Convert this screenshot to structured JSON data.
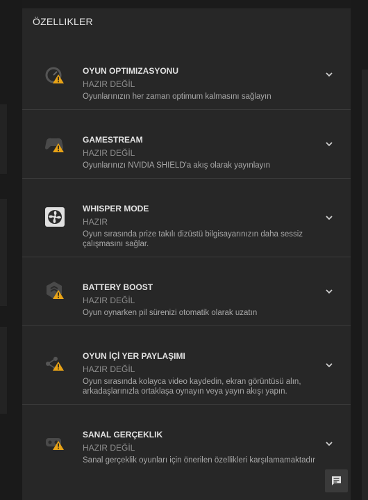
{
  "panel": {
    "title": "ÖZELLIKLER"
  },
  "features": [
    {
      "name": "OYUN OPTIMIZASYONU",
      "status": "HAZIR DEĞİL",
      "description": "Oyunlarınızın her zaman optimum kalmasını sağlayın",
      "icon": "game-optimization-icon",
      "warning": true
    },
    {
      "name": "GAMESTREAM",
      "status": "HAZIR DEĞİL",
      "description": "Oyunlarınızı NVIDIA SHIELD'a akış olarak yayınlayın",
      "icon": "gamestream-controller-icon",
      "warning": true
    },
    {
      "name": "WHISPER MODE",
      "status": "HAZIR",
      "description": "Oyun sırasında prize takılı dizüstü bilgisayarınızın daha sessiz çalışmasını sağlar.",
      "icon": "whisper-mode-fan-icon",
      "warning": false
    },
    {
      "name": "BATTERY BOOST",
      "status": "HAZIR DEĞİL",
      "description": "Oyun oynarken pil sürenizi otomatik olarak uzatın",
      "icon": "battery-boost-icon",
      "warning": true
    },
    {
      "name": "OYUN İÇİ YER PAYLAŞIMI",
      "status": "HAZIR DEĞİL",
      "description": "Oyun sırasında kolayca video kaydedin, ekran görüntüsü alın, arkadaşlarınızla ortaklaşa oynayın veya yayın akışı yapın.",
      "icon": "share-icon",
      "warning": true
    },
    {
      "name": "SANAL GERÇEKLIK",
      "status": "HAZIR DEĞİL",
      "description": "Sanal gerçeklik oyunları için önerilen özellikleri karşılamamaktadır",
      "icon": "vr-headset-icon",
      "warning": true
    }
  ],
  "colors": {
    "panel": "#272727",
    "warning": "#e8a317",
    "divider": "#3a3a3a"
  },
  "chat_button": {
    "icon": "chat-feedback-icon"
  }
}
